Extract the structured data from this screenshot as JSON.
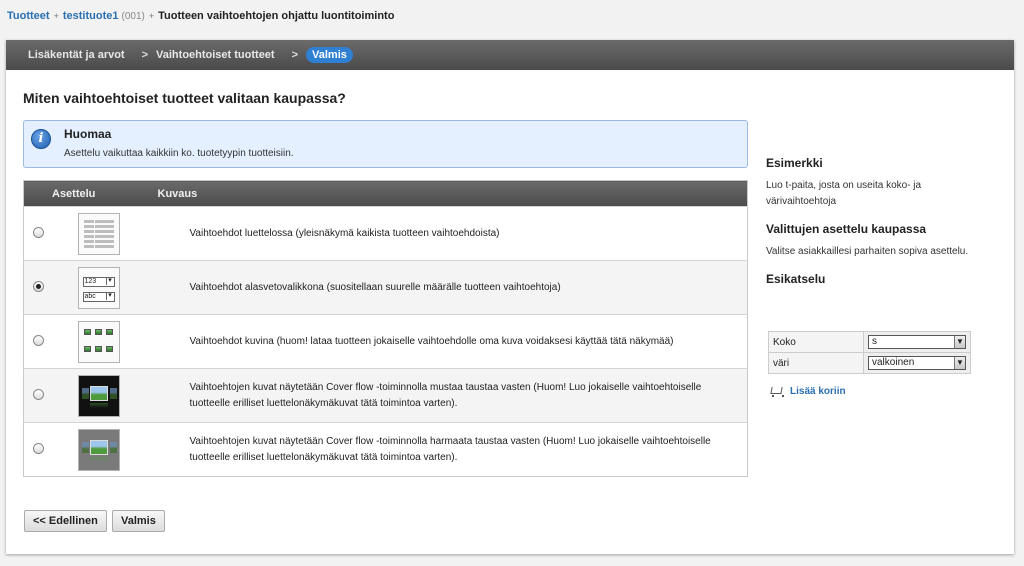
{
  "breadcrumb": {
    "root": "Tuotteet",
    "product": "testituote1",
    "product_number": "(001)",
    "current": "Tuotteen vaihtoehtojen ohjattu luontitoiminto"
  },
  "wizard_steps": [
    {
      "label": "Lisäkentät ja arvot",
      "active": false
    },
    {
      "label": "Vaihtoehtoiset tuotteet",
      "active": false
    },
    {
      "label": "Valmis",
      "active": true
    }
  ],
  "page_title": "Miten vaihtoehtoiset tuotteet valitaan kaupassa?",
  "notice": {
    "title": "Huomaa",
    "body": "Asettelu vaikuttaa kaikkiin ko. tuotetyypin tuotteisiin."
  },
  "table": {
    "col_layout": "Asettelu",
    "col_description": "Kuvaus",
    "rows": [
      {
        "thumb": "list-layout-icon",
        "selected": false,
        "description": "Vaihtoehdot luettelossa (yleisnäkymä kaikista tuotteen vaihtoehdoista)"
      },
      {
        "thumb": "dropdown-layout-icon",
        "selected": true,
        "description": "Vaihtoehdot alasvetovalikkona (suositellaan suurelle määrälle tuotteen vaihtoehtoja)"
      },
      {
        "thumb": "image-grid-layout-icon",
        "selected": false,
        "description": "Vaihtoehdot kuvina (huom! lataa tuotteen jokaiselle vaihtoehdolle oma kuva voidaksesi käyttää tätä näkymää)"
      },
      {
        "thumb": "coverflow-black-icon",
        "selected": false,
        "description": "Vaihtoehtojen kuvat näytetään Cover flow -toiminnolla mustaa taustaa vasten (Huom! Luo jokaiselle vaihtoehtoiselle tuotteelle erilliset luettelonäkymäkuvat tätä toimintoa varten)."
      },
      {
        "thumb": "coverflow-gray-icon",
        "selected": false,
        "description": "Vaihtoehtojen kuvat näytetään Cover flow -toiminnolla harmaata taustaa vasten (Huom! Luo jokaiselle vaihtoehtoiselle tuotteelle erilliset luettelonäkymäkuvat tätä toimintoa varten)."
      }
    ]
  },
  "thumb_labels": {
    "dd_top": "123",
    "dd_bottom": "abc"
  },
  "buttons": {
    "prev": "<< Edellinen",
    "done": "Valmis"
  },
  "sidebar": {
    "example_title": "Esimerkki",
    "example_text": "Luo t-paita, josta on useita koko- ja värivaihtoehtoja",
    "layout_title": "Valittujen asettelu kaupassa",
    "layout_text": "Valitse asiakkaillesi parhaiten sopiva asettelu.",
    "preview_title": "Esikatselu",
    "preview": {
      "size_label": "Koko",
      "size_value": "s",
      "color_label": "väri",
      "color_value": "valkoinen"
    },
    "add_to_cart": "Lisää koriin"
  },
  "colors": {
    "accent": "#2f7fd3",
    "link": "#2a6fb0",
    "header_bar": "#555555",
    "notice_bg": "#e4efff"
  }
}
